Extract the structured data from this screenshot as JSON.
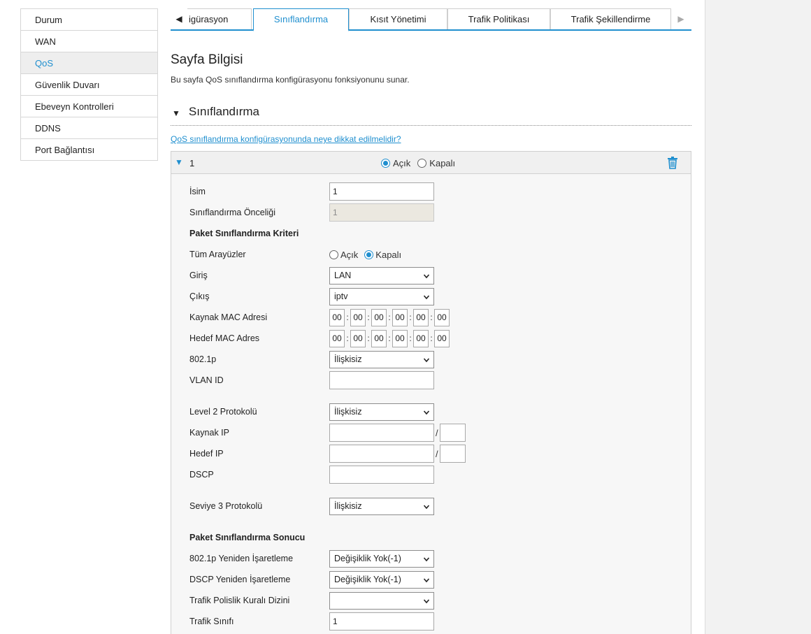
{
  "sidebar": {
    "items": [
      {
        "label": "Durum"
      },
      {
        "label": "WAN"
      },
      {
        "label": "QoS"
      },
      {
        "label": "Güvenlik Duvarı"
      },
      {
        "label": "Ebeveyn Kontrolleri"
      },
      {
        "label": "DDNS"
      },
      {
        "label": "Port Bağlantısı"
      }
    ],
    "active": "QoS"
  },
  "tabs": {
    "items": [
      {
        "label": "igürasyon"
      },
      {
        "label": "Sınıflandırma"
      },
      {
        "label": "Kısıt Yönetimi"
      },
      {
        "label": "Trafik Politikası"
      },
      {
        "label": "Trafik Şekillendirme"
      }
    ],
    "active": "Sınıflandırma"
  },
  "page": {
    "title": "Sayfa Bilgisi",
    "description": "Bu sayfa QoS sınıflandırma konfigürasyonu fonksiyonunu sunar.",
    "section_title": "Sınıflandırma",
    "help_link": "QoS sınıflandırma konfigürasyonunda neye dikkat edilmelidir?"
  },
  "entry": {
    "number": "1",
    "on_label": "Açık",
    "off_label": "Kapalı",
    "state": "Açık"
  },
  "form": {
    "name": {
      "label": "İsim",
      "value": "1"
    },
    "priority": {
      "label": "Sınıflandırma Önceliği",
      "value": "1"
    },
    "criteria_heading": "Paket Sınıflandırma Kriteri",
    "all_interfaces": {
      "label": "Tüm Arayüzler",
      "on_label": "Açık",
      "off_label": "Kapalı",
      "value": "Kapalı"
    },
    "ingress": {
      "label": "Giriş",
      "value": "LAN"
    },
    "egress": {
      "label": "Çıkış",
      "value": "iptv"
    },
    "src_mac": {
      "label": "Kaynak MAC Adresi",
      "octets": [
        "00",
        "00",
        "00",
        "00",
        "00",
        "00"
      ]
    },
    "dst_mac": {
      "label": "Hedef MAC Adres",
      "octets": [
        "00",
        "00",
        "00",
        "00",
        "00",
        "00"
      ]
    },
    "p8021": {
      "label": "802.1p",
      "value": "İlişkisiz"
    },
    "vlan_id": {
      "label": "VLAN ID",
      "value": ""
    },
    "l2_protocol": {
      "label": "Level 2 Protokolü",
      "value": "İlişkisiz"
    },
    "src_ip": {
      "label": "Kaynak IP",
      "value": "",
      "mask": ""
    },
    "dst_ip": {
      "label": "Hedef IP",
      "value": "",
      "mask": ""
    },
    "dscp": {
      "label": "DSCP",
      "value": ""
    },
    "l3_protocol": {
      "label": "Seviye 3 Protokolü",
      "value": "İlişkisiz"
    },
    "result_heading": "Paket Sınıflandırma Sonucu",
    "remark_8021p": {
      "label": "802.1p Yeniden İşaretleme",
      "value": "Değişiklik Yok(-1)"
    },
    "remark_dscp": {
      "label": "DSCP Yeniden İşaretleme",
      "value": "Değişiklik Yok(-1)"
    },
    "policy_index": {
      "label": "Trafik Polislik Kuralı Dizini",
      "value": ""
    },
    "traffic_class": {
      "label": "Trafik Sınıfı",
      "value": "1"
    }
  },
  "icons": {
    "tab_left": "triangle-left-icon",
    "tab_right": "triangle-right-icon",
    "collapse": "triangle-down-icon",
    "delete": "trash-icon",
    "dropdown": "chevron-down-icon"
  },
  "colors": {
    "accent": "#1f8fcf"
  }
}
